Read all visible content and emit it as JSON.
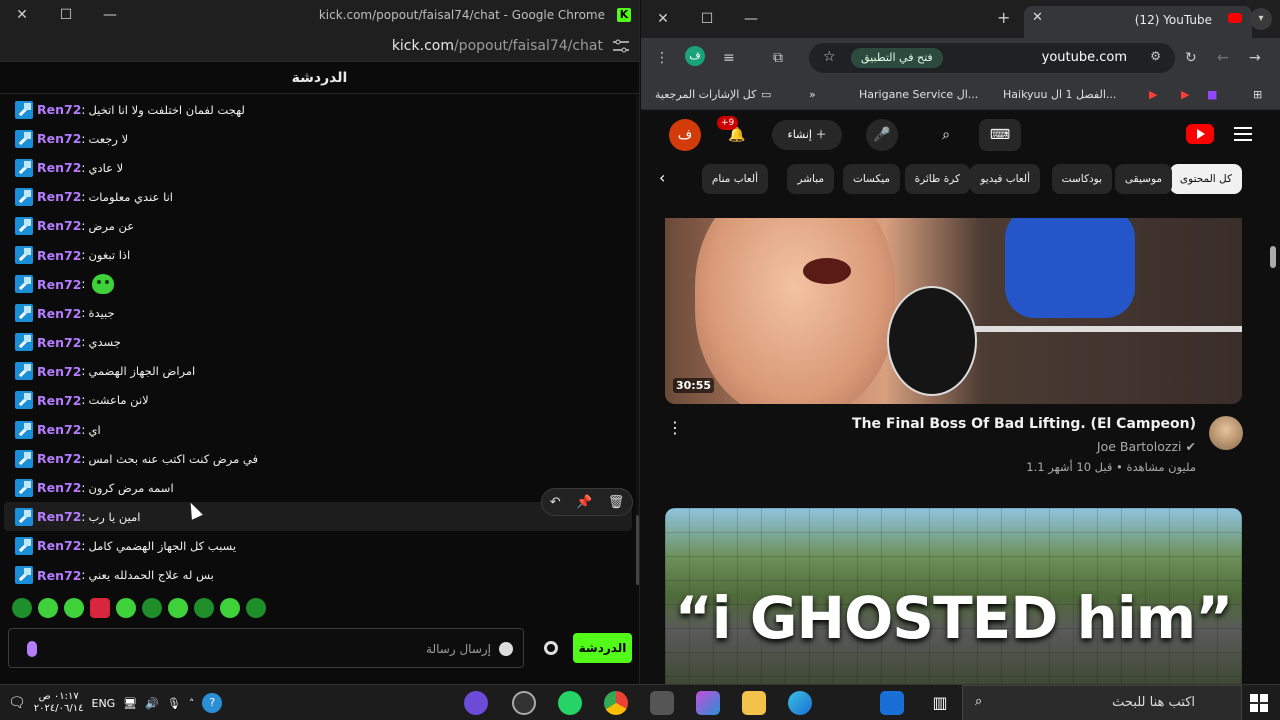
{
  "kick": {
    "window_title": "kick.com/popout/faisal74/chat - Google Chrome",
    "url_host": "kick.com",
    "url_path": "/popout/faisal74/chat",
    "chat_header": "الدردشة",
    "messages": [
      {
        "user": "Ren72",
        "text": "لهجت لفمان اختلفت ولا انا اتخيل"
      },
      {
        "user": "Ren72",
        "text": "لا رجعت"
      },
      {
        "user": "Ren72",
        "text": "لا عادي"
      },
      {
        "user": "Ren72",
        "text": "انا عندي معلومات"
      },
      {
        "user": "Ren72",
        "text": "عن مرض"
      },
      {
        "user": "Ren72",
        "text": "اذا تبغون"
      },
      {
        "user": "Ren72",
        "text": "",
        "emote": true
      },
      {
        "user": "Ren72",
        "text": "جبيدة"
      },
      {
        "user": "Ren72",
        "text": "جسدي"
      },
      {
        "user": "Ren72",
        "text": "امراض الجهاز الهضمي"
      },
      {
        "user": "Ren72",
        "text": "لانن ماعشت"
      },
      {
        "user": "Ren72",
        "text": "اي"
      },
      {
        "user": "Ren72",
        "text": "في مرض كنت اكتب عنه بحث امس"
      },
      {
        "user": "Ren72",
        "text": "اسمه مرض كرون"
      },
      {
        "user": "Ren72",
        "text": "امين يا رب"
      },
      {
        "user": "Ren72",
        "text": "يسبب كل الجهاز الهضمي كامل"
      },
      {
        "user": "Ren72",
        "text": "بس له علاج الحمدلله يعني"
      }
    ],
    "input_placeholder": "إرسال رسالة",
    "send_label": "الدردشة"
  },
  "chrome": {
    "tab_title": "(12) YouTube",
    "url": "youtube.com",
    "open_in_app": "فتح في التطبيق",
    "avatar_letter": "ف",
    "bookmarks": {
      "all": "كل الإشارات المرجعية",
      "harigane": "Harigane Service ال...",
      "haikyuu": "Haikyuu الفصل 1 ال..."
    }
  },
  "youtube": {
    "create_label": "إنشاء",
    "notif_count": "+9",
    "avatar_letter": "ف",
    "chips": [
      "كل المحتوى",
      "موسيقى",
      "بودكاست",
      "ألعاب فيديو",
      "كرة طائرة",
      "ميكسات",
      "مباشر",
      "ألعاب منام"
    ],
    "video1": {
      "duration": "30:55",
      "title": "The Final Boss Of Bad Lifting. (El Campeon)",
      "channel": "Joe Bartolozzi",
      "stats": "1.1 مليون مشاهدة • قبل 10 أشهر"
    },
    "video2": {
      "thumb_text": "“i GHOSTED him”"
    }
  },
  "taskbar": {
    "search_placeholder": "اكتب هنا للبحث",
    "lang": "ENG",
    "time": "٠١:١٧ ص",
    "date": "٢٠٢٤/٠٦/١٤"
  }
}
